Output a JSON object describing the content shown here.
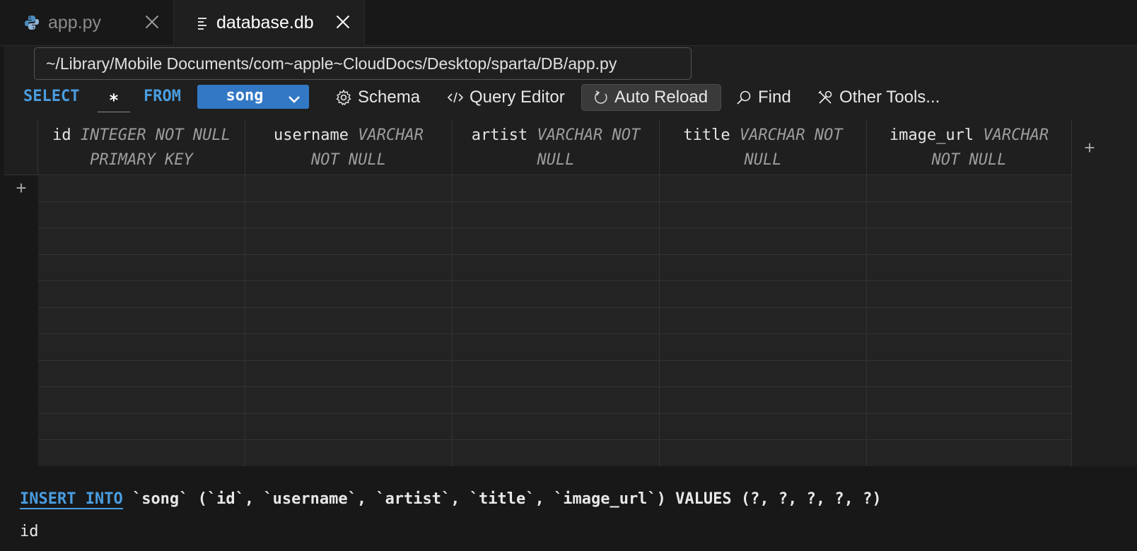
{
  "tabs": [
    {
      "label": "app.py",
      "icon": "python-icon",
      "active": false
    },
    {
      "label": "database.db",
      "icon": "file-lines-icon",
      "active": true
    }
  ],
  "tooltip": "~/Library/Mobile Documents/com~apple~CloudDocs/Desktop/sparta/DB/app.py",
  "toolbar": {
    "select_kw": "SELECT",
    "columns_value": "*",
    "from_kw": "FROM",
    "table_value": "song",
    "schema_label": "Schema",
    "query_editor_label": "Query Editor",
    "auto_reload_label": "Auto Reload",
    "find_label": "Find",
    "other_tools_label": "Other Tools..."
  },
  "table": {
    "columns": [
      {
        "name": "id",
        "type_line1": "INTEGER NOT NULL",
        "type_line2": "PRIMARY KEY"
      },
      {
        "name": "username",
        "type_line1": "VARCHAR",
        "type_line2": "NOT NULL"
      },
      {
        "name": "artist",
        "type_line1": "VARCHAR NOT",
        "type_line2": "NULL"
      },
      {
        "name": "title",
        "type_line1": "VARCHAR NOT",
        "type_line2": "NULL"
      },
      {
        "name": "image_url",
        "type_line1": "VARCHAR",
        "type_line2": "NOT NULL"
      }
    ],
    "add_row_symbol": "+",
    "add_column_symbol": "+"
  },
  "insert": {
    "keyword": "INSERT INTO",
    "rest": " `song` (`id`, `username`, `artist`, `title`, `image_url`) VALUES (?, ?, ?, ?, ?)",
    "field_label": "id"
  },
  "colors": {
    "accent": "#4a9de0",
    "select_bg": "#3378c5",
    "background": "#1f1f1f"
  }
}
